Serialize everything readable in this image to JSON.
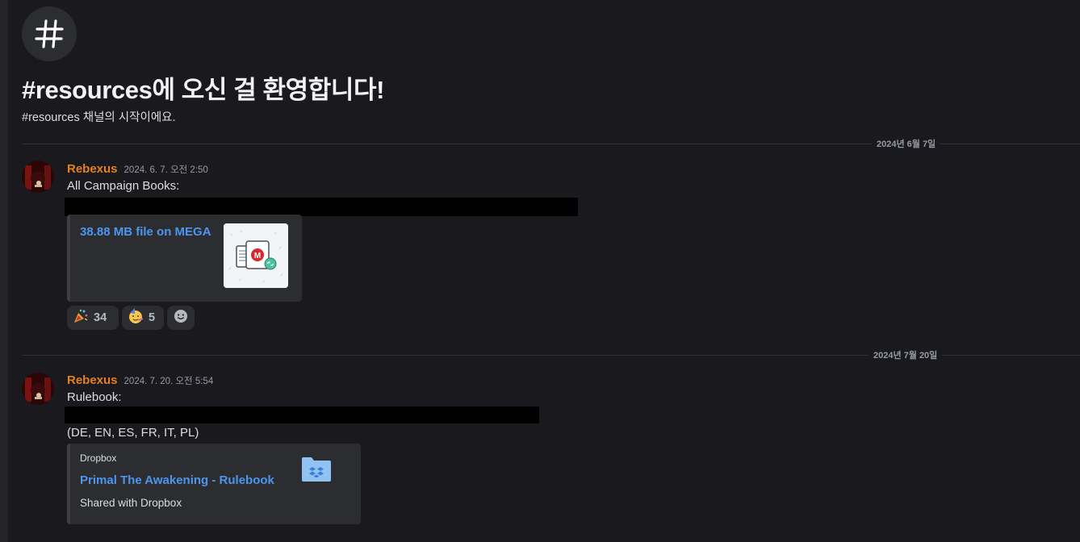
{
  "channel": {
    "welcome_title": "#resources에 오신 걸 환영합니다!",
    "welcome_subtitle": "#resources 채널의 시작이에요."
  },
  "dividers": [
    "2024년 6월 7일",
    "2024년 7월 20일"
  ],
  "messages": [
    {
      "author": "Rebexus",
      "timestamp": "2024. 6. 7. 오전 2:50",
      "text": "All Campaign Books:",
      "embed": {
        "title": "38.88 MB file on MEGA",
        "thumbnail_icon": "mega-file-icon"
      },
      "reactions": [
        {
          "emoji": "party-popper-icon",
          "count": "34"
        },
        {
          "emoji": "partying-face-icon",
          "count": "5"
        }
      ]
    },
    {
      "author": "Rebexus",
      "timestamp": "2024. 7. 20. 오전 5:54",
      "text": "Rulebook:",
      "text2": "(DE, EN, ES, FR, IT, PL)",
      "embed": {
        "provider": "Dropbox",
        "title": "Primal The Awakening - Rulebook",
        "description": "Shared with Dropbox",
        "thumbnail_icon": "dropbox-folder-icon"
      }
    }
  ],
  "colors": {
    "author": "#e67e22",
    "link": "#4d95ed",
    "background": "#1a1a1e"
  }
}
